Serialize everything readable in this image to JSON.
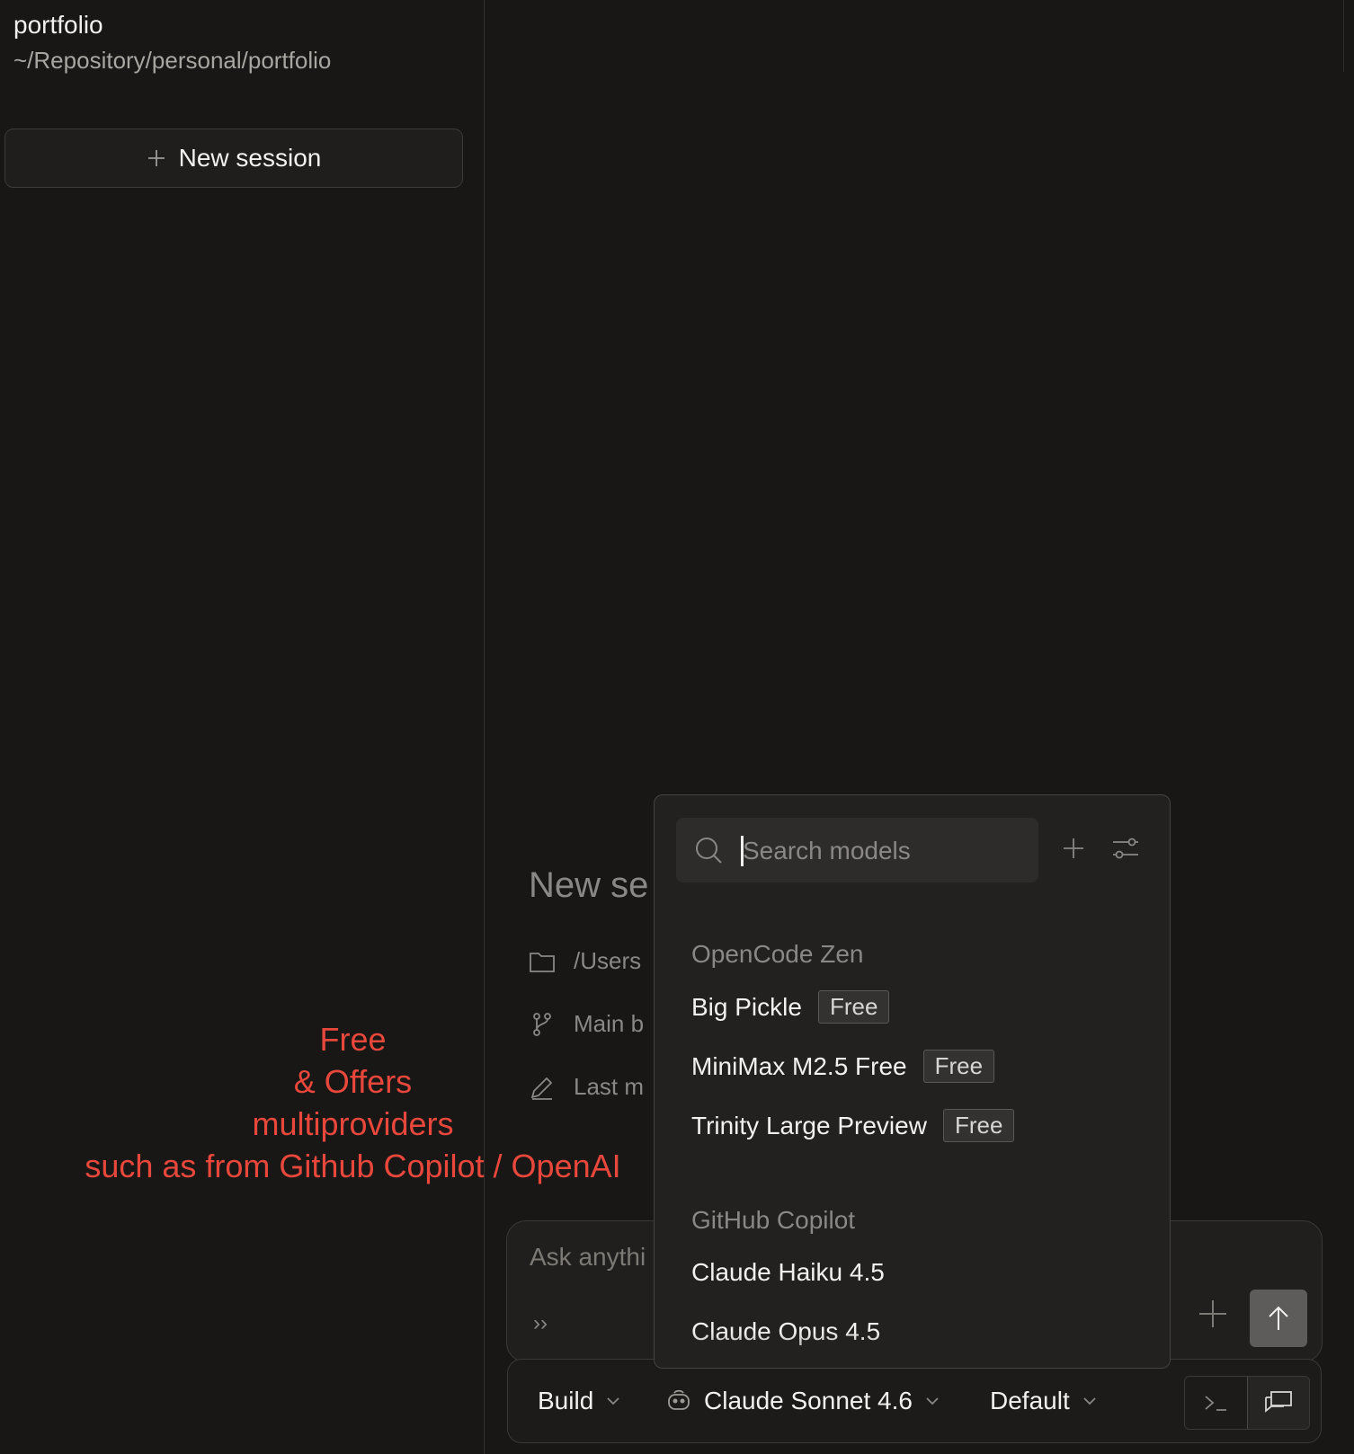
{
  "sidebar": {
    "project_name": "portfolio",
    "project_path": "~/Repository/personal/portfolio",
    "new_session_label": "New session"
  },
  "main": {
    "title": "New se",
    "meta": [
      {
        "icon": "folder-icon",
        "text": "/Users"
      },
      {
        "icon": "branch-icon",
        "text": "Main b"
      },
      {
        "icon": "pencil-icon",
        "text": "Last m"
      }
    ]
  },
  "annotation": {
    "line1": "Free",
    "line2": "& Offers",
    "line3": "multiproviders",
    "line4": "such as from Github Copilot / OpenAI",
    "color": "#e8473b"
  },
  "composer": {
    "placeholder": "Ask anythi",
    "chevron": "››"
  },
  "model_picker": {
    "search_placeholder": "Search models",
    "groups": [
      {
        "name": "OpenCode Zen",
        "items": [
          {
            "label": "Big Pickle",
            "badge": "Free"
          },
          {
            "label": "MiniMax M2.5 Free",
            "badge": "Free"
          },
          {
            "label": "Trinity Large Preview",
            "badge": "Free"
          }
        ]
      },
      {
        "name": "GitHub Copilot",
        "items": [
          {
            "label": "Claude Haiku 4.5"
          },
          {
            "label": "Claude Opus 4.5"
          }
        ]
      }
    ]
  },
  "bottom_bar": {
    "agent": "Build",
    "model": "Claude Sonnet 4.6",
    "variant": "Default"
  }
}
